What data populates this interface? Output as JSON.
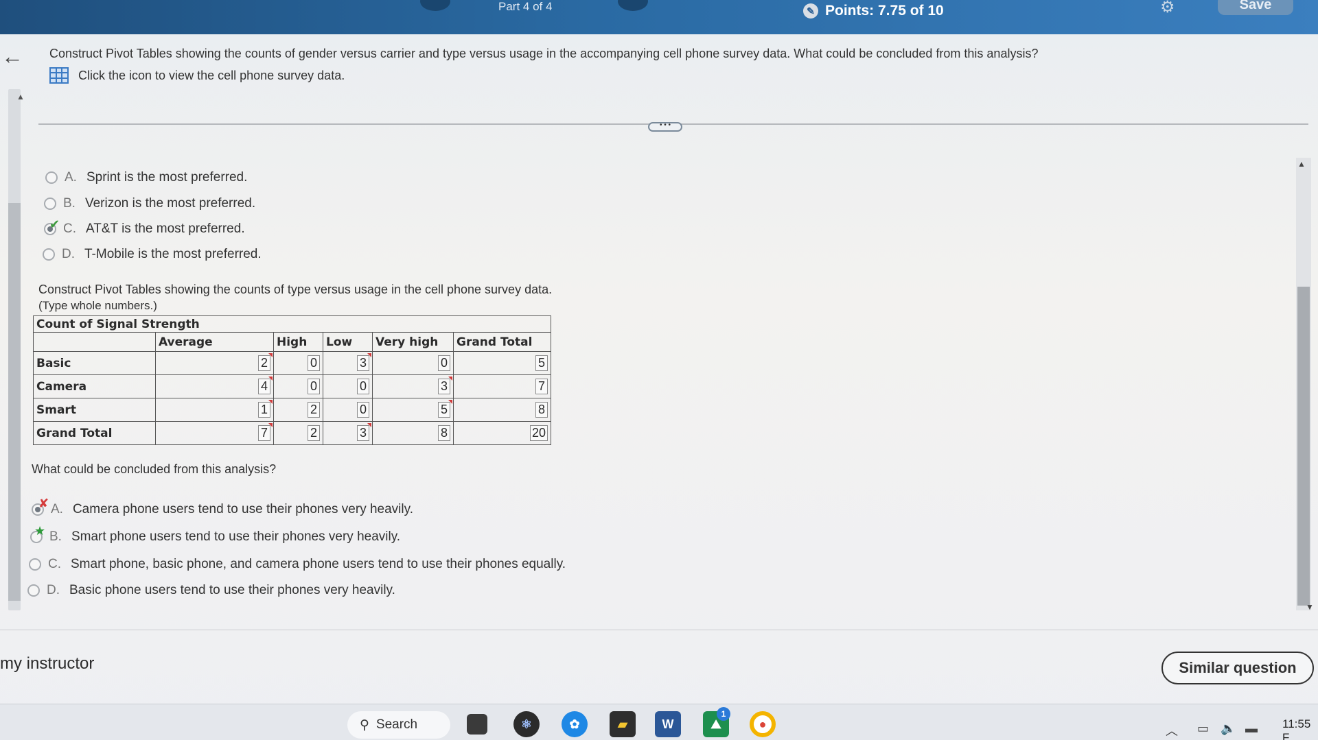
{
  "topbar": {
    "part": "Part 4 of 4",
    "points": "Points: 7.75 of 10",
    "save": "Save"
  },
  "question": {
    "text": "Construct Pivot Tables showing the counts of gender versus carrier and type versus usage in the accompanying cell phone survey data. What could be concluded from this analysis?",
    "data_link": "Click the icon to view the cell phone survey data.",
    "more": "• • •"
  },
  "part1_options": [
    {
      "letter": "A.",
      "text": "Sprint is the most preferred."
    },
    {
      "letter": "B.",
      "text": "Verizon is the most preferred."
    },
    {
      "letter": "C.",
      "text": "AT&T is the most preferred."
    },
    {
      "letter": "D.",
      "text": "T-Mobile is the most preferred."
    }
  ],
  "pivot": {
    "instruction": "Construct Pivot Tables showing the counts of type versus usage in the cell phone survey data.",
    "hint": "(Type whole numbers.)",
    "title": "Count of Signal Strength",
    "columns": [
      "",
      "Average",
      "High",
      "Low",
      "Very high",
      "Grand Total"
    ],
    "rows": [
      {
        "label": "Basic",
        "values": [
          "2",
          "0",
          "3",
          "0",
          "5"
        ]
      },
      {
        "label": "Camera",
        "values": [
          "4",
          "0",
          "0",
          "3",
          "7"
        ]
      },
      {
        "label": "Smart",
        "values": [
          "1",
          "2",
          "0",
          "5",
          "8"
        ]
      },
      {
        "label": "Grand Total",
        "values": [
          "7",
          "2",
          "3",
          "8",
          "20"
        ]
      }
    ]
  },
  "conclusion": {
    "prompt": "What could be concluded from this analysis?",
    "options": [
      {
        "letter": "A.",
        "text": "Camera phone users tend to use their phones very heavily."
      },
      {
        "letter": "B.",
        "text": "Smart phone users tend to use their phones very heavily."
      },
      {
        "letter": "C.",
        "text": "Smart phone, basic phone, and camera phone users tend to use their phones equally."
      },
      {
        "letter": "D.",
        "text": "Basic phone users tend to use their phones very heavily."
      }
    ]
  },
  "footer": {
    "instructor": "my instructor",
    "similar": "Similar question"
  },
  "taskbar": {
    "search": "Search",
    "clock": "11:55 F",
    "badge": "1"
  }
}
